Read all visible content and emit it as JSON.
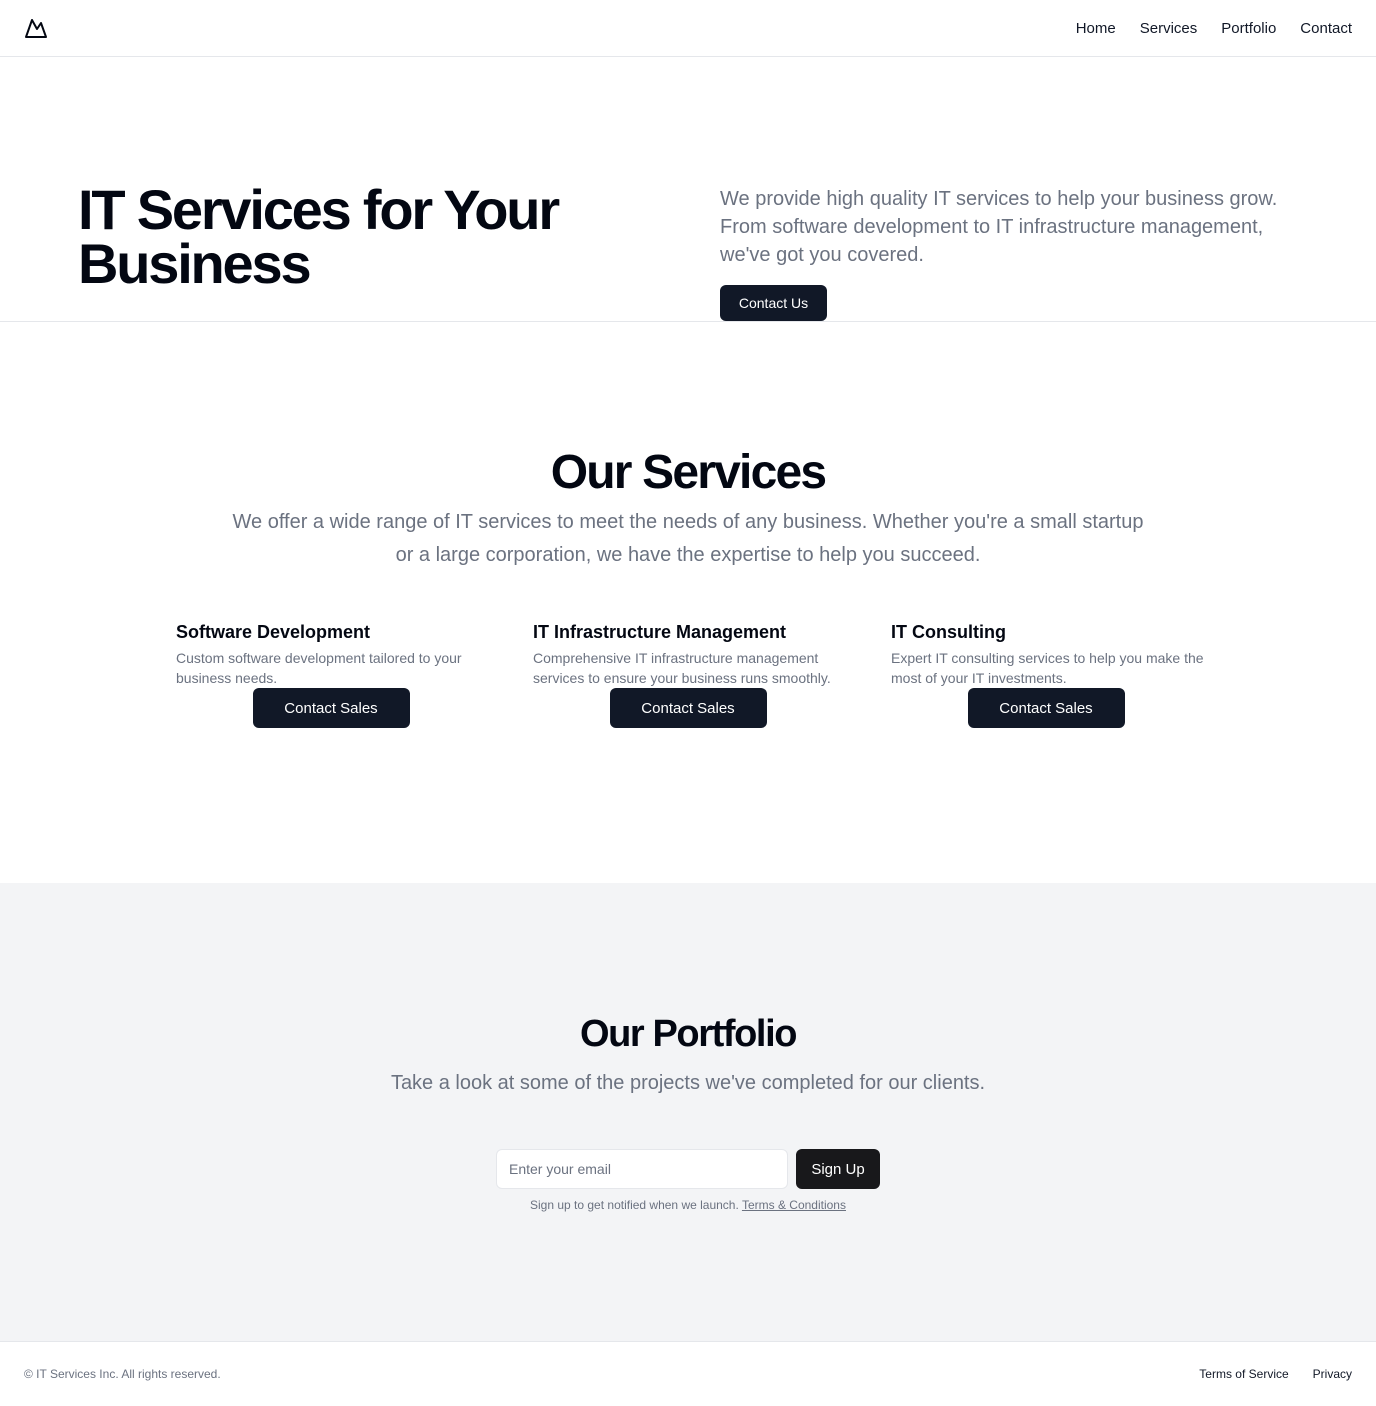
{
  "header": {
    "logo": "mountain-icon",
    "nav": [
      {
        "label": "Home"
      },
      {
        "label": "Services"
      },
      {
        "label": "Portfolio"
      },
      {
        "label": "Contact"
      }
    ]
  },
  "hero": {
    "title": "IT Services for Your Business",
    "description": "We provide high quality IT services to help your business grow. From software development to IT infrastructure management, we've got you covered.",
    "cta_label": "Contact Us"
  },
  "services": {
    "title": "Our Services",
    "subtitle": "We offer a wide range of IT services to meet the needs of any business. Whether you're a small startup or a large corporation, we have the expertise to help you succeed.",
    "items": [
      {
        "title": "Software Development",
        "description": "Custom software development tailored to your business needs.",
        "button_label": "Contact Sales"
      },
      {
        "title": "IT Infrastructure Management",
        "description": "Comprehensive IT infrastructure management services to ensure your business runs smoothly.",
        "button_label": "Contact Sales"
      },
      {
        "title": "IT Consulting",
        "description": "Expert IT consulting services to help you make the most of your IT investments.",
        "button_label": "Contact Sales"
      }
    ]
  },
  "portfolio": {
    "title": "Our Portfolio",
    "subtitle": "Take a look at some of the projects we've completed for our clients.",
    "email_placeholder": "Enter your email",
    "email_value": "",
    "signup_label": "Sign Up",
    "fine_print": "Sign up to get notified when we launch.",
    "terms_link": "Terms & Conditions"
  },
  "footer": {
    "copyright": "© IT Services Inc. All rights reserved.",
    "links": [
      {
        "label": "Terms of Service"
      },
      {
        "label": "Privacy"
      }
    ]
  },
  "colors": {
    "primary_button": "#111827",
    "muted_text": "#6b7280",
    "portfolio_bg": "#f3f4f6"
  }
}
